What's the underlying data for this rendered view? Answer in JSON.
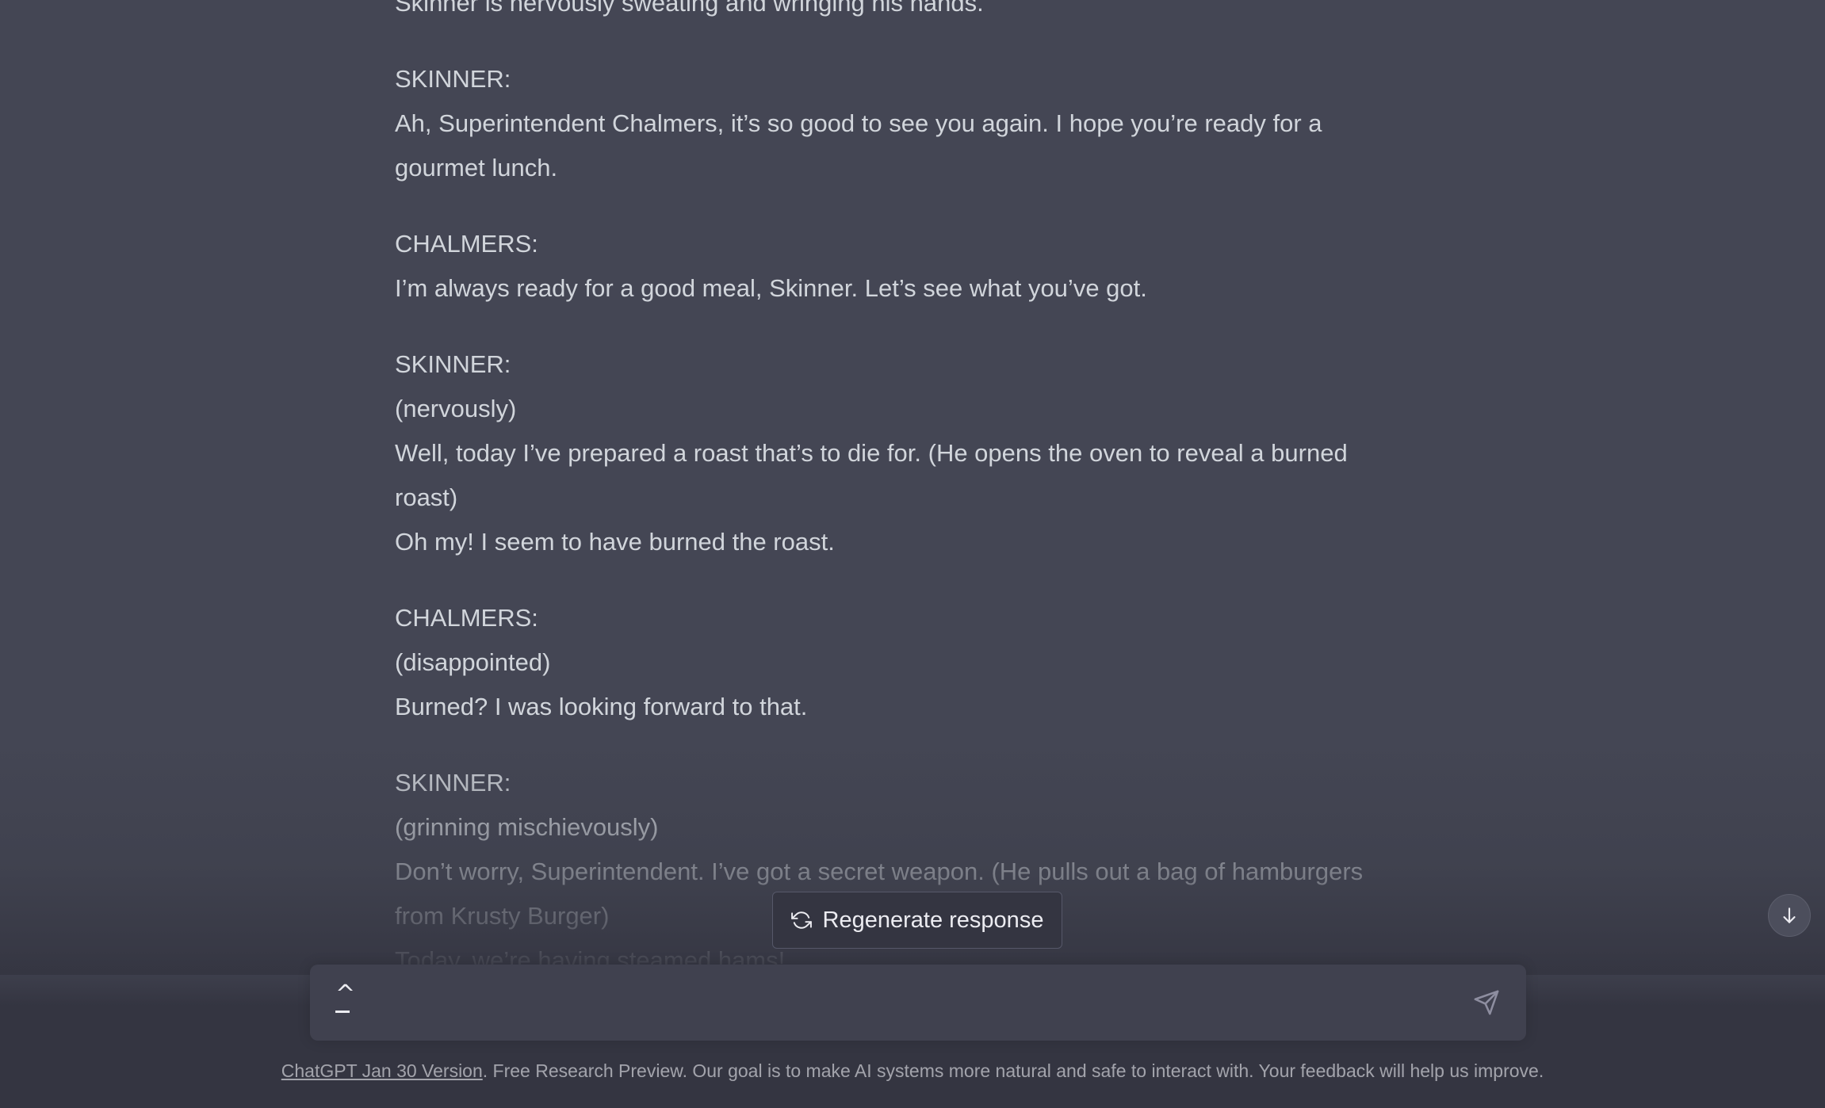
{
  "message": {
    "lines": [
      [
        "Skinner is nervously sweating and wringing his hands."
      ],
      [
        "SKINNER:",
        "Ah, Superintendent Chalmers, it’s so good to see you again. I hope you’re ready for a",
        "gourmet lunch."
      ],
      [
        "CHALMERS:",
        "I’m always ready for a good meal, Skinner. Let’s see what you’ve got."
      ],
      [
        "SKINNER:",
        "(nervously)",
        "Well, today I’ve prepared a roast that’s to die for. (He opens the oven to reveal a burned",
        "roast)",
        "Oh my! I seem to have burned the roast."
      ],
      [
        "CHALMERS:",
        "(disappointed)",
        "Burned? I was looking forward to that."
      ],
      [
        "SKINNER:",
        "(grinning mischievously)",
        "Don’t worry, Superintendent. I’ve got a secret weapon. (He pulls out a bag of hamburgers",
        "from Krusty Burger)",
        "Today, we’re having steamed hams!"
      ]
    ]
  },
  "regenerate": {
    "label": "Regenerate response",
    "icon": "refresh-icon"
  },
  "composer": {
    "value": "",
    "cursor_glyph": "^",
    "send_icon": "send-icon"
  },
  "scroll_button": {
    "icon": "arrow-down-icon"
  },
  "footer": {
    "link_text": "ChatGPT Jan 30 Version",
    "text": ". Free Research Preview. Our goal is to make AI systems more natural and safe to interact with. Your feedback will help us improve."
  },
  "colors": {
    "message_bg": "#444654",
    "page_bg": "#343541",
    "input_bg": "#40414f",
    "text": "#d1d5db"
  }
}
